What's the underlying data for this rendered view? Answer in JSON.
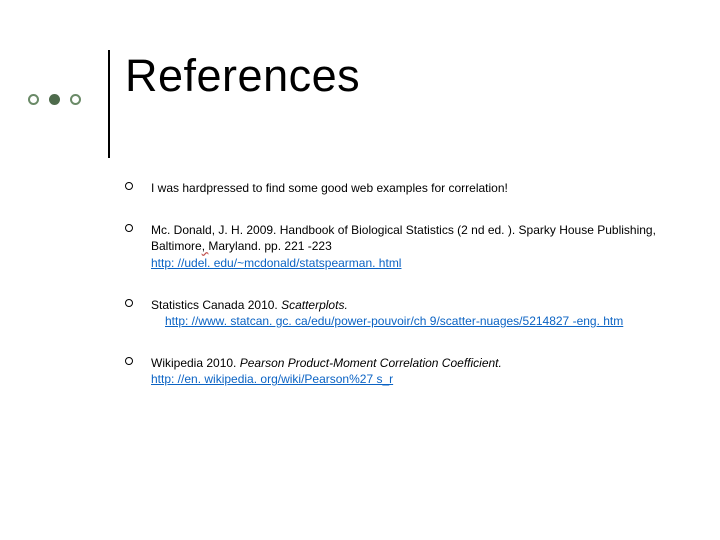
{
  "title": "References",
  "items": [
    {
      "full": "I was hardpressed to find some good web examples for correlation!"
    },
    {
      "prefix": "Mc. Donald, J. H. 2009. Handbook of Biological Statistics (2 nd ed. ). Sparky House Publishing, Baltimore",
      "wavy": ", ",
      "suffix": "Maryland. pp. 221 -223",
      "url": "http: //udel. edu/~mcdonald/statspearman. html"
    },
    {
      "prefix": "Statistics Canada 2010. ",
      "italic": "Scatterplots.",
      "url": "http: //www. statcan. gc. ca/edu/power-pouvoir/ch 9/scatter-nuages/5214827 -eng. htm",
      "indentUrl": true
    },
    {
      "prefix": "Wikipedia 2010. ",
      "italic": "Pearson Product-Moment Correlation Coefficient.",
      "url": "http: //en. wikipedia. org/wiki/Pearson%27 s_r"
    }
  ]
}
